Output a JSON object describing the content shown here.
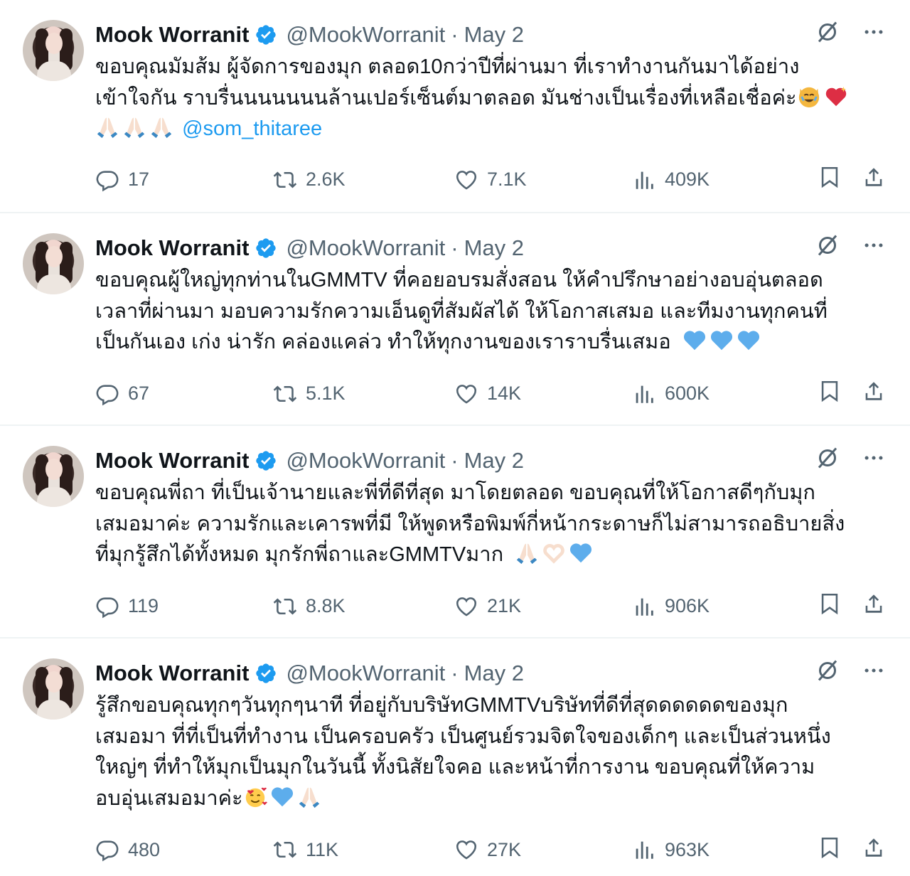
{
  "tweets": [
    {
      "name": "Mook Worranit",
      "handle": "@MookWorranit",
      "sep": "·",
      "date": "May 2",
      "lines": [
        "ขอบคุณมัมส้ม ผู้จัดการของมุก ตลอด10กว่าปีที่ผ่านมา ที่เราทำงานกันมาได้อย่าง",
        "เข้าใจกัน ราบรื่นนนนนนนล้านเปอร์เซ็นต์มาตลอด มันช่างเป็นเรื่องที่เหลือเชื่อค่ะ"
      ],
      "mention": "@som_thitaree",
      "stats": {
        "replies": "17",
        "reposts": "2.6K",
        "likes": "7.1K",
        "views": "409K"
      }
    },
    {
      "name": "Mook Worranit",
      "handle": "@MookWorranit",
      "sep": "·",
      "date": "May 2",
      "lines": [
        "ขอบคุณผู้ใหญ่ทุกท่านในGMMTV ที่คอยอบรมสั่งสอน ให้คำปรึกษาอย่างอบอุ่นตลอด",
        "เวลาที่ผ่านมา มอบความรักความเอ็นดูที่สัมผัสได้ ให้โอกาสเสมอ และทีมงานทุกคนที่",
        "เป็นกันเอง เก่ง น่ารัก คล่องแคล่ว ทำให้ทุกงานของเราราบรื่นเสมอ"
      ],
      "stats": {
        "replies": "67",
        "reposts": "5.1K",
        "likes": "14K",
        "views": "600K"
      }
    },
    {
      "name": "Mook Worranit",
      "handle": "@MookWorranit",
      "sep": "·",
      "date": "May 2",
      "lines": [
        "ขอบคุณพี่ถา ที่เป็นเจ้านายและพี่ที่ดีที่สุด มาโดยตลอด ขอบคุณที่ให้โอกาสดีๆกับมุก",
        "เสมอมาค่ะ ความรักและเคารพที่มี ให้พูดหรือพิมพ์กี่หน้ากระดาษก็ไม่สามารถอธิบายสิ่ง",
        "ที่มุกรู้สึกได้ทั้งหมด มุกรักพี่ถาและGMMTVมาก"
      ],
      "stats": {
        "replies": "119",
        "reposts": "8.8K",
        "likes": "21K",
        "views": "906K"
      }
    },
    {
      "name": "Mook Worranit",
      "handle": "@MookWorranit",
      "sep": "·",
      "date": "May 2",
      "lines": [
        "รู้สึกขอบคุณทุกๆวันทุกๆนาที ที่อยู่กับบริษัทGMMTVบริษัทที่ดีที่สุดดดดดดของมุก",
        "เสมอมา ที่ที่เป็นที่ทำงาน เป็นครอบครัว เป็นศูนย์รวมจิตใจของเด็กๆ และเป็นส่วนหนึ่ง",
        "ใหญ่ๆ ที่ทำให้มุกเป็นมุกในวันนี้ ทั้งนิสัยใจคอ และหน้าที่การงาน ขอบคุณที่ให้ความ",
        "อบอุ่นเสมอมาค่ะ"
      ],
      "stats": {
        "replies": "480",
        "reposts": "11K",
        "likes": "27K",
        "views": "963K"
      }
    }
  ]
}
